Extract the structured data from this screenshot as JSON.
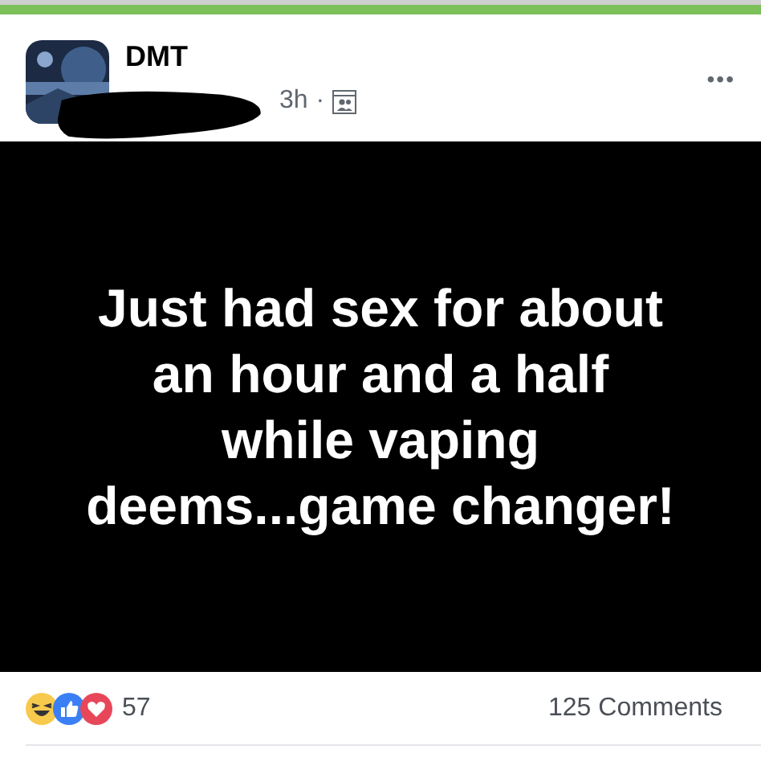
{
  "post": {
    "author": "DMT",
    "time": "3h",
    "separator": "·",
    "more": "•••"
  },
  "status_text": "Just had sex for about an hour and a half while vaping deems...game changer!",
  "footer": {
    "reaction_count": "57",
    "comments": "125 Comments"
  }
}
